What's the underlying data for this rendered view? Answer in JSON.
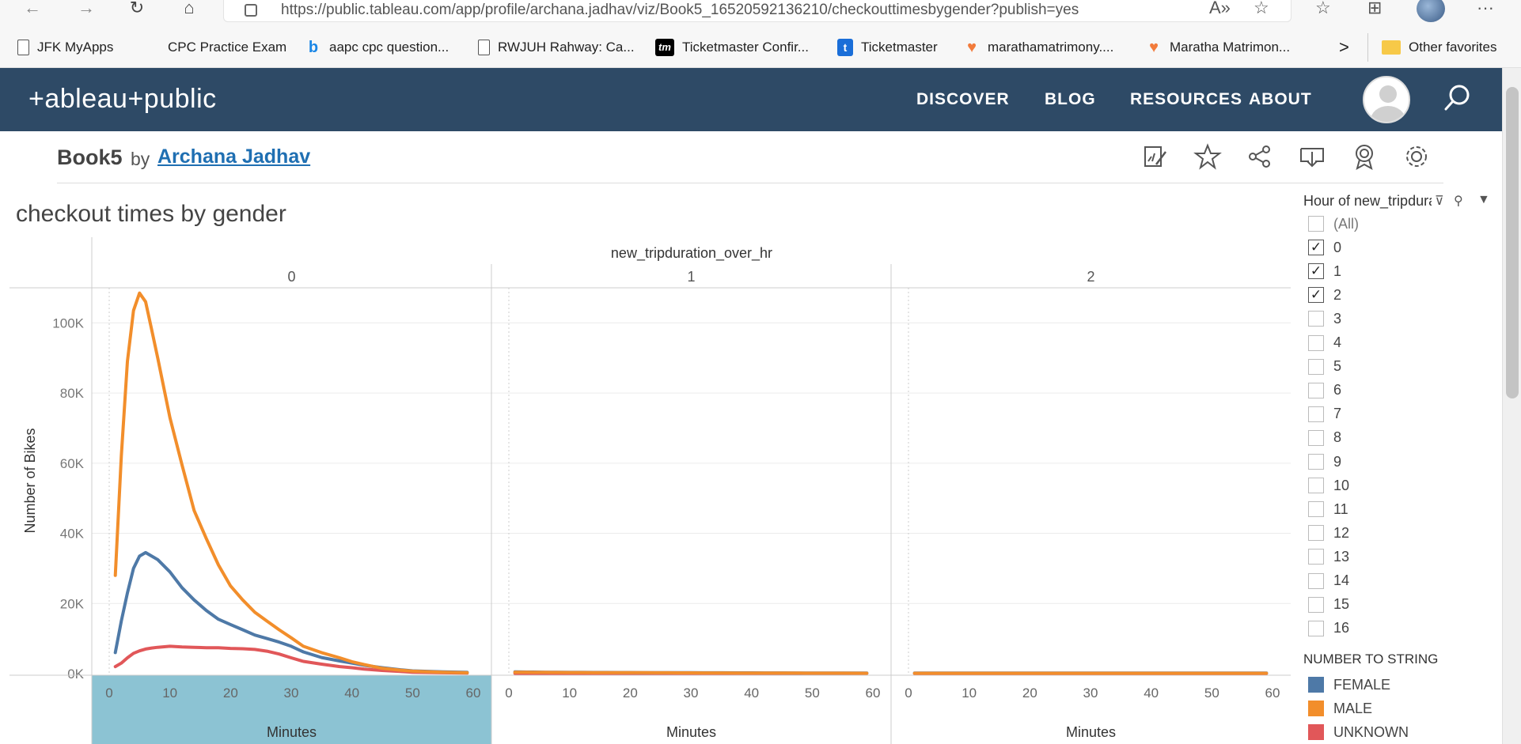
{
  "browser": {
    "url": "https://public.tableau.com/app/profile/archana.jadhav/viz/Book5_16520592136210/checkouttimesbygender?publish=yes",
    "bookmarks": [
      {
        "label": "JFK MyApps",
        "icon": "page-icon"
      },
      {
        "label": "CPC Practice Exam",
        "icon": "none"
      },
      {
        "label": "aapc cpc question...",
        "icon": "bing-icon"
      },
      {
        "label": "RWJUH Rahway: Ca...",
        "icon": "page-icon"
      },
      {
        "label": "Ticketmaster Confir...",
        "icon": "tm-icon"
      },
      {
        "label": "Ticketmaster",
        "icon": "t-icon"
      },
      {
        "label": "marathamatrimony....",
        "icon": "matrimony-icon"
      },
      {
        "label": "Maratha Matrimon...",
        "icon": "matrimony-icon"
      }
    ],
    "more_bookmarks": ">",
    "other_favorites": "Other favorites"
  },
  "header": {
    "logo": "+ableau+public",
    "nav": [
      "DISCOVER",
      "BLOG",
      "RESOURCES",
      "ABOUT"
    ]
  },
  "workbook": {
    "title": "Book5",
    "by": "by",
    "author": "Archana Jadhav"
  },
  "viz": {
    "title": "checkout times by gender"
  },
  "colors": {
    "female": "#4e79a7",
    "male": "#f28e2b",
    "unknown": "#e15759",
    "header_bg": "#2e4a66",
    "highlight_axis": "#8cc3d3"
  },
  "filter": {
    "title": "Hour of new_tripduration_over_hr",
    "items": [
      {
        "label": "(All)",
        "checked": false
      },
      {
        "label": "0",
        "checked": true
      },
      {
        "label": "1",
        "checked": true
      },
      {
        "label": "2",
        "checked": true
      },
      {
        "label": "3",
        "checked": false
      },
      {
        "label": "4",
        "checked": false
      },
      {
        "label": "5",
        "checked": false
      },
      {
        "label": "6",
        "checked": false
      },
      {
        "label": "7",
        "checked": false
      },
      {
        "label": "8",
        "checked": false
      },
      {
        "label": "9",
        "checked": false
      },
      {
        "label": "10",
        "checked": false
      },
      {
        "label": "11",
        "checked": false
      },
      {
        "label": "12",
        "checked": false
      },
      {
        "label": "13",
        "checked": false
      },
      {
        "label": "14",
        "checked": false
      },
      {
        "label": "15",
        "checked": false
      },
      {
        "label": "16",
        "checked": false
      }
    ]
  },
  "legend": {
    "title": "NUMBER TO STRING",
    "items": [
      {
        "label": "FEMALE",
        "color": "#4e79a7"
      },
      {
        "label": "MALE",
        "color": "#f28e2b"
      },
      {
        "label": "UNKNOWN",
        "color": "#e15759"
      }
    ]
  },
  "chart_data": {
    "type": "line",
    "title": "checkout times by gender",
    "column_header": "new_tripduration_over_hr",
    "panels": [
      "0",
      "1",
      "2"
    ],
    "xlabel": "Minutes",
    "ylabel": "Number of Bikes",
    "xlim": [
      0,
      60
    ],
    "ylim": [
      0,
      110000
    ],
    "x_ticks": [
      0,
      10,
      20,
      30,
      40,
      50,
      60
    ],
    "y_ticks": [
      "0K",
      "20K",
      "40K",
      "60K",
      "80K",
      "100K"
    ],
    "y_tick_values": [
      0,
      20000,
      40000,
      60000,
      80000,
      100000
    ],
    "x": [
      1,
      2,
      3,
      4,
      5,
      6,
      7,
      8,
      10,
      12,
      14,
      16,
      18,
      20,
      22,
      24,
      26,
      28,
      30,
      32,
      35,
      38,
      40,
      42,
      45,
      48,
      50,
      55,
      59
    ],
    "series": [
      {
        "name": "FEMALE",
        "color": "#4e79a7",
        "panels": [
          [
            6000,
            15000,
            23000,
            30000,
            33500,
            34500,
            33500,
            32500,
            29000,
            24500,
            21000,
            18000,
            15500,
            14000,
            12500,
            11000,
            10000,
            9000,
            7800,
            6200,
            4600,
            3600,
            3000,
            2400,
            1700,
            1100,
            800,
            500,
            350
          ],
          [
            500,
            480,
            460,
            440,
            420,
            400,
            390,
            380,
            360,
            350,
            340,
            330,
            320,
            310,
            300,
            290,
            280,
            270,
            260,
            250,
            240,
            230,
            220,
            210,
            200,
            190,
            180,
            170,
            160
          ],
          [
            150,
            150,
            150,
            150,
            150,
            150,
            150,
            150,
            150,
            150,
            150,
            150,
            150,
            150,
            150,
            150,
            150,
            150,
            150,
            150,
            150,
            150,
            150,
            150,
            150,
            150,
            150,
            150,
            150
          ]
        ]
      },
      {
        "name": "MALE",
        "color": "#f28e2b",
        "panels": [
          [
            28000,
            62000,
            89000,
            103500,
            108500,
            106000,
            98000,
            90000,
            73000,
            59500,
            46500,
            38500,
            31000,
            25000,
            21000,
            17500,
            15000,
            12500,
            10200,
            7800,
            6000,
            4500,
            3400,
            2600,
            1500,
            1000,
            700,
            400,
            250
          ],
          [
            400,
            390,
            380,
            370,
            360,
            350,
            340,
            330,
            320,
            310,
            300,
            290,
            280,
            270,
            260,
            250,
            240,
            230,
            220,
            210,
            200,
            190,
            180,
            170,
            160,
            150,
            140,
            130,
            120
          ],
          [
            120,
            120,
            120,
            120,
            120,
            120,
            120,
            120,
            120,
            120,
            120,
            120,
            120,
            120,
            120,
            120,
            120,
            120,
            120,
            120,
            120,
            120,
            120,
            120,
            120,
            120,
            120,
            120,
            120
          ]
        ]
      },
      {
        "name": "UNKNOWN",
        "color": "#e15759",
        "panels": [
          [
            2000,
            3000,
            4500,
            5800,
            6500,
            7000,
            7300,
            7500,
            7800,
            7600,
            7500,
            7400,
            7400,
            7200,
            7100,
            6900,
            6400,
            5600,
            4500,
            3500,
            2700,
            2000,
            1700,
            1300,
            900,
            600,
            400,
            250,
            150
          ],
          [
            100,
            100,
            100,
            100,
            100,
            100,
            100,
            100,
            100,
            100,
            100,
            100,
            100,
            100,
            100,
            100,
            100,
            100,
            100,
            100,
            100,
            100,
            100,
            100,
            100,
            100,
            100,
            100,
            100
          ],
          [
            50,
            50,
            50,
            50,
            50,
            50,
            50,
            50,
            50,
            50,
            50,
            50,
            50,
            50,
            50,
            50,
            50,
            50,
            50,
            50,
            50,
            50,
            50,
            50,
            50,
            50,
            50,
            50,
            50
          ]
        ]
      }
    ],
    "grid": true,
    "legend": "right"
  }
}
